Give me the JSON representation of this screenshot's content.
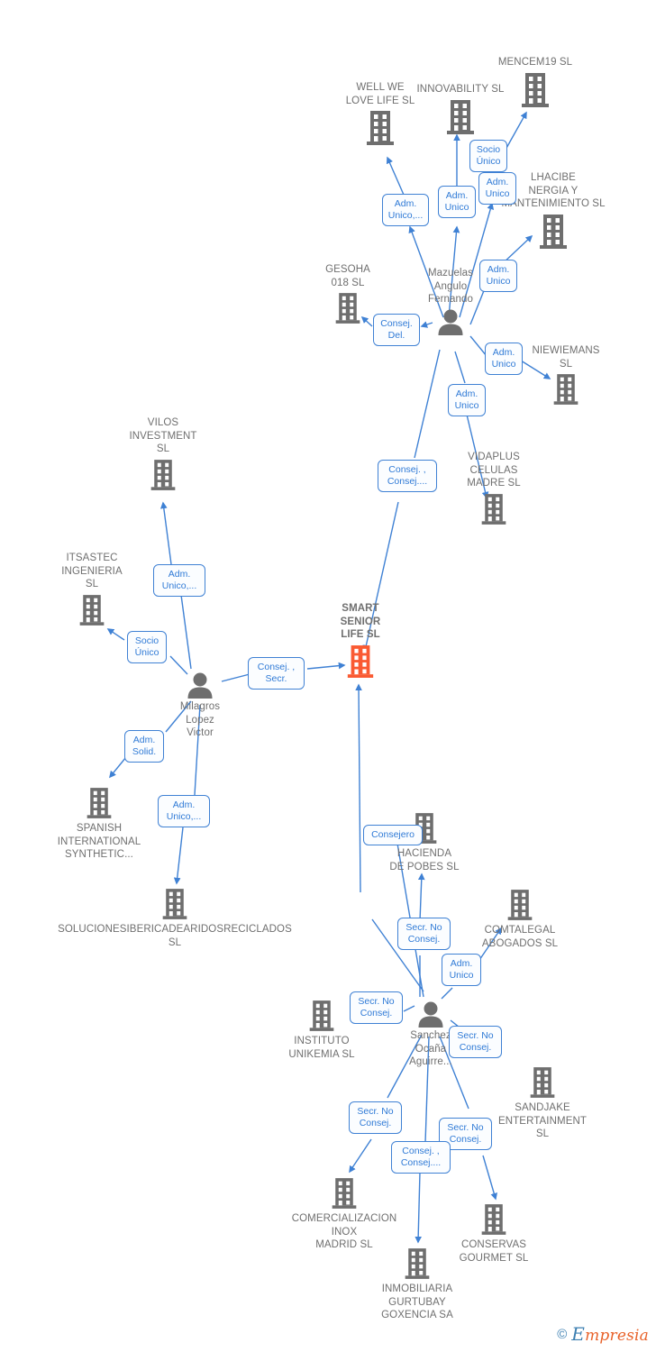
{
  "diagram": {
    "title": "SMART SENIOR LIFE SL corporate network",
    "focus_company": "SMART SENIOR LIFE  SL",
    "colors": {
      "company_icon": "#6e6e6e",
      "focus_icon": "#fa5a32",
      "edge": "#3f81d4",
      "label_text": "#2f7ad6",
      "caption_text": "#6f6f6f"
    }
  },
  "watermark": {
    "copyright": "©",
    "brand_first": "E",
    "brand_rest": "mpresia"
  },
  "nodes": [
    {
      "id": "mencem19",
      "type": "company",
      "label": "MENCEM19  SL"
    },
    {
      "id": "wellwelove",
      "type": "company",
      "label": "WELL WE\nLOVE LIFE  SL"
    },
    {
      "id": "innovability",
      "type": "company",
      "label": "INNOVABILITY SL"
    },
    {
      "id": "alhacibe",
      "type": "company",
      "label": "LHACIBE\nNERGIA Y\nMANTENIMIENTO SL"
    },
    {
      "id": "gesoha",
      "type": "company",
      "label": "GESOHA\n018  SL"
    },
    {
      "id": "mazuelas",
      "type": "person",
      "label": "Mazuelas\nAngulo\nFernando"
    },
    {
      "id": "niewiemans",
      "type": "company",
      "label": "NIEWIEMANS\nSL"
    },
    {
      "id": "vidaplus",
      "type": "company",
      "label": "VIDAPLUS\nCELULAS\nMADRE  SL"
    },
    {
      "id": "vilos",
      "type": "company",
      "label": "VILOS\nINVESTMENT\nSL"
    },
    {
      "id": "itsastec",
      "type": "company",
      "label": "ITSASTEC\nINGENIERIA\nSL"
    },
    {
      "id": "milagros",
      "type": "person",
      "label": "Milagros\nLopez\nVictor"
    },
    {
      "id": "smartsenior",
      "type": "focus",
      "label": "SMART\nSENIOR\nLIFE  SL"
    },
    {
      "id": "spanish",
      "type": "company",
      "label": "SPANISH\nINTERNATIONAL\nSYNTHETIC..."
    },
    {
      "id": "soluciones",
      "type": "company",
      "label": "SOLUCIONESIBERICADEARIDOSRECICLADOS\nSL"
    },
    {
      "id": "hacienda",
      "type": "company",
      "label": "HACIENDA\nDE POBES  SL"
    },
    {
      "id": "comtalegal",
      "type": "company",
      "label": "COMTALEGAL\nABOGADOS SL"
    },
    {
      "id": "instituto",
      "type": "company",
      "label": "INSTITUTO\nUNIKEMIA  SL"
    },
    {
      "id": "sanchez",
      "type": "person",
      "label": "Sanchez\nOcaña\nAguirre..."
    },
    {
      "id": "sandjake",
      "type": "company",
      "label": "SANDJAKE\nENTERTAINMENT\nSL"
    },
    {
      "id": "comercializacion",
      "type": "company",
      "label": "COMERCIALIZACION\nINOX\nMADRID SL"
    },
    {
      "id": "inmobiliaria",
      "type": "company",
      "label": "INMOBILIARIA\nGURTUBAY\nGOXENCIA SA"
    },
    {
      "id": "conservas",
      "type": "company",
      "label": "CONSERVAS\nGOURMET SL"
    }
  ],
  "edge_labels": [
    {
      "id": "el-wellwelove",
      "text": "Adm.\nUnico,..."
    },
    {
      "id": "el-innovability",
      "text": "Adm.\nUnico"
    },
    {
      "id": "el-socio-innov",
      "text": "Socio\nÚnico"
    },
    {
      "id": "el-mencem19",
      "text": "Adm.\nUnico"
    },
    {
      "id": "el-alhacibe",
      "text": "Adm.\nUnico"
    },
    {
      "id": "el-gesoha",
      "text": "Consej.\nDel."
    },
    {
      "id": "el-niewiemans",
      "text": "Adm.\nUnico"
    },
    {
      "id": "el-vidaplus",
      "text": "Adm.\nUnico"
    },
    {
      "id": "el-mazuelas-smart",
      "text": "Consej. ,\nConsej...."
    },
    {
      "id": "el-vilos",
      "text": "Adm.\nUnico,..."
    },
    {
      "id": "el-itsastec",
      "text": "Socio\nÚnico"
    },
    {
      "id": "el-milagros-smart",
      "text": "Consej. ,\nSecr."
    },
    {
      "id": "el-spanish",
      "text": "Adm.\nSolid."
    },
    {
      "id": "el-soluciones",
      "text": "Adm.\nUnico,..."
    },
    {
      "id": "el-hacienda",
      "text": "Consejero"
    },
    {
      "id": "el-sanchez-smart",
      "text": "Secr.  No\nConsej."
    },
    {
      "id": "el-comtalegal",
      "text": "Adm.\nUnico"
    },
    {
      "id": "el-instituto",
      "text": "Secr.  No\nConsej."
    },
    {
      "id": "el-sandjake",
      "text": "Secr.  No\nConsej."
    },
    {
      "id": "el-comercializacion",
      "text": "Secr.  No\nConsej."
    },
    {
      "id": "el-conservas",
      "text": "Secr.  No\nConsej."
    },
    {
      "id": "el-inmobiliaria",
      "text": "Consej. ,\nConsej...."
    }
  ]
}
